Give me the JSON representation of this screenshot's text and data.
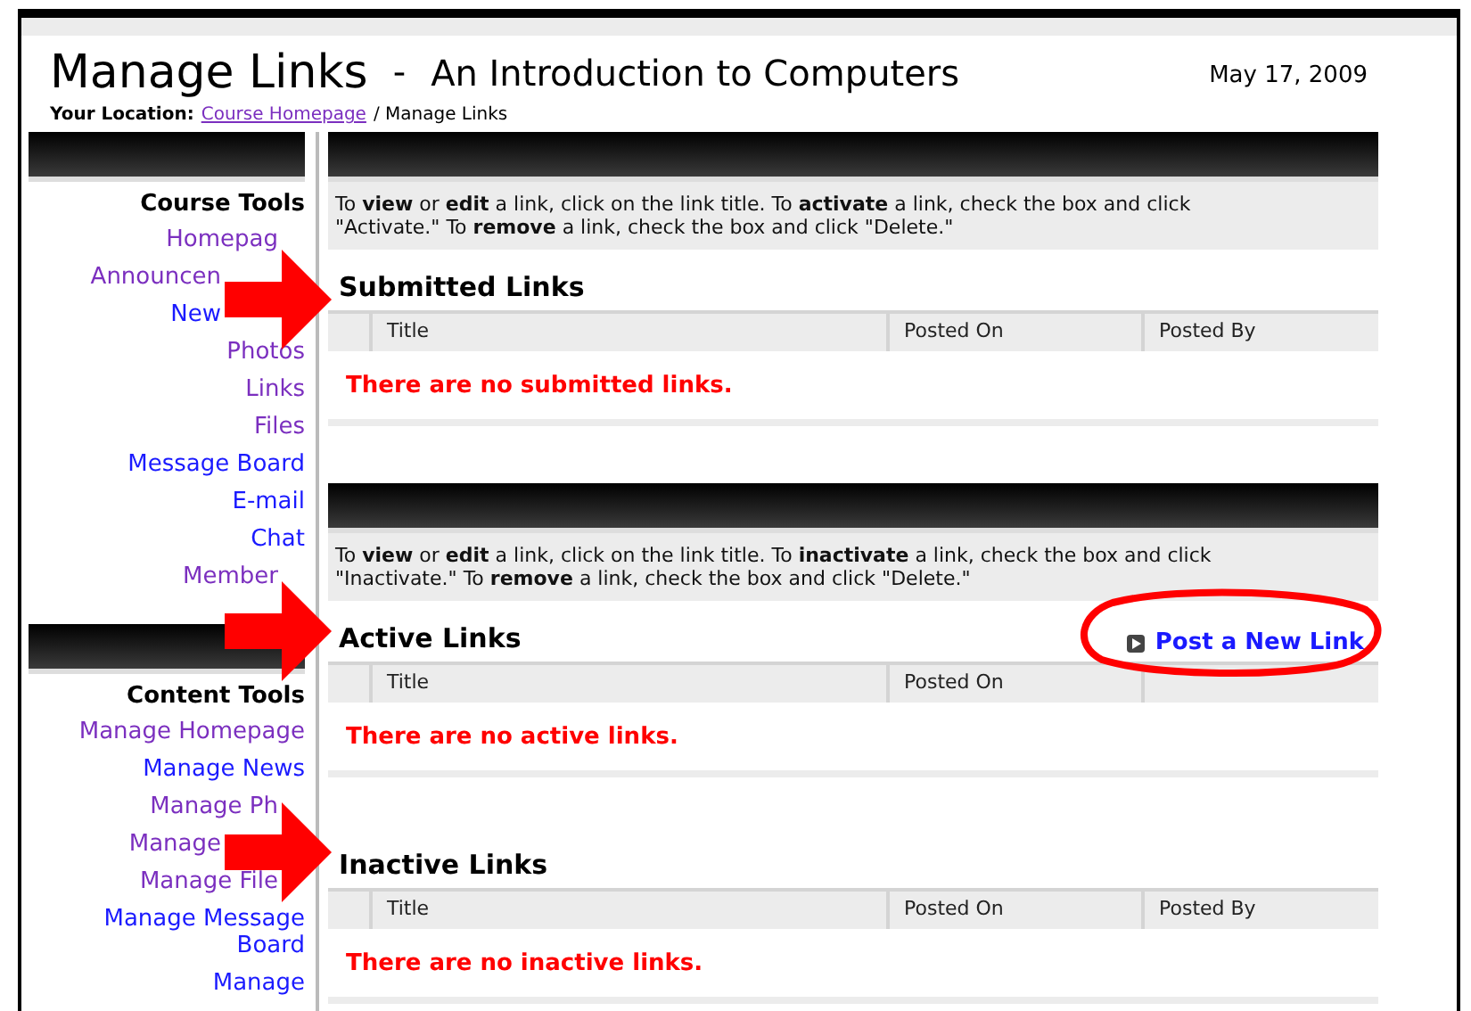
{
  "header": {
    "title": "Manage Links",
    "separator": "-",
    "course": "An Introduction to Computers",
    "date": "May 17, 2009"
  },
  "breadcrumb": {
    "label": "Your Location:",
    "link": "Course Homepage",
    "current": "/ Manage Links"
  },
  "sidebar": [
    {
      "heading": "Course Tools",
      "items": [
        {
          "label": "Homepag",
          "visited": true,
          "kind": "under-arrow-tip"
        },
        {
          "label": "Announcen",
          "visited": true,
          "kind": "under-arrow"
        },
        {
          "label": "New",
          "visited": false,
          "kind": "under-arrow"
        },
        {
          "label": "Photos",
          "visited": true,
          "kind": "link"
        },
        {
          "label": "Links",
          "visited": true,
          "kind": "link"
        },
        {
          "label": "Files",
          "visited": true,
          "kind": "link"
        },
        {
          "label": "Message Board",
          "visited": false,
          "kind": "link"
        },
        {
          "label": "E-mail",
          "visited": false,
          "kind": "link"
        },
        {
          "label": "Chat",
          "visited": false,
          "kind": "link"
        },
        {
          "label": "Member",
          "visited": true,
          "kind": "under-arrow-tip"
        }
      ]
    },
    {
      "heading": "Content Tools",
      "items": [
        {
          "label": "Manage Homepage",
          "visited": true,
          "kind": "link"
        },
        {
          "label": "Manage News",
          "visited": false,
          "kind": "link"
        },
        {
          "label": "Manage Ph",
          "visited": true,
          "kind": "under-arrow-tip"
        },
        {
          "label": "Manage",
          "visited": true,
          "kind": "under-arrow"
        },
        {
          "label": "Manage File",
          "visited": true,
          "kind": "under-arrow-tip"
        },
        {
          "label": "Manage Message Board",
          "visited": false,
          "kind": "link"
        },
        {
          "label": "Manage",
          "visited": false,
          "kind": "link"
        }
      ]
    }
  ],
  "groups": [
    {
      "instructions": "To **view** or **edit** a link, click on the link title. To **activate** a link, check the box and click \"Activate.\" To **remove** a link, check the box and click \"Delete.\"",
      "sections": [
        {
          "title": "Submitted Links",
          "columns": [
            "Title",
            "Posted On",
            "Posted By"
          ],
          "empty_message": "There are no submitted links."
        }
      ]
    },
    {
      "instructions": "To **view** or **edit** a link, click on the link title. To **inactivate** a link, check the box and click \"Inactivate.\" To **remove** a link, check the box and click \"Delete.\"",
      "sections": [
        {
          "title": "Active Links",
          "action": "Post a New Link",
          "columns": [
            "Title",
            "Posted On"
          ],
          "empty_message": "There are no active links."
        },
        {
          "title": "Inactive Links",
          "columns": [
            "Title",
            "Posted On",
            "Posted By"
          ],
          "empty_message": "There are no inactive links."
        }
      ]
    }
  ]
}
